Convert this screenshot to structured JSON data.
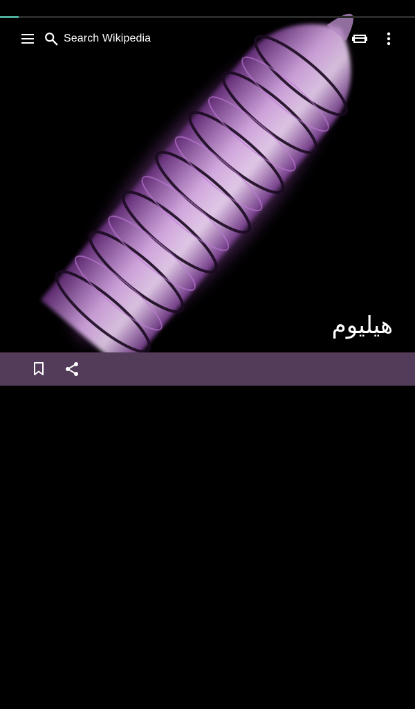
{
  "progress": {
    "fraction": 0.045,
    "color": "#4fb0a0"
  },
  "toolbar": {
    "menu_icon": "menu-icon",
    "search_icon": "search-icon",
    "search_placeholder": "Search Wikipedia",
    "tabs_icon": "tabs-icon",
    "overflow_icon": "more-vert-icon"
  },
  "article": {
    "title": "هيليوم"
  },
  "action_bar": {
    "background": "#533c59",
    "bookmark_icon": "bookmark-icon",
    "share_icon": "share-icon"
  }
}
